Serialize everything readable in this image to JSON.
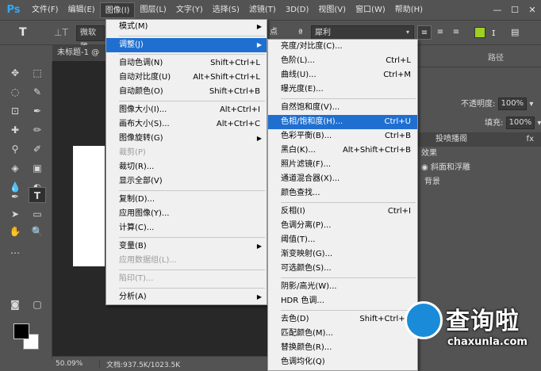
{
  "app": {
    "logo": "Ps"
  },
  "menubar": {
    "items": [
      "文件(F)",
      "编辑(E)",
      "图像(I)",
      "图层(L)",
      "文字(Y)",
      "选择(S)",
      "滤镜(T)",
      "3D(D)",
      "视图(V)",
      "窗口(W)",
      "帮助(H)"
    ],
    "active_index": 2,
    "window_controls": [
      "—",
      "☐",
      "✕"
    ]
  },
  "options": {
    "font_family": "微软雅",
    "font_size_unit": "点",
    "aa": "犀利"
  },
  "document": {
    "tab_title": "未标题-1 @"
  },
  "status": {
    "zoom": "50.09%",
    "doc_info": "文档:937.5K/1023.5K"
  },
  "panels": {
    "tabs": [
      "",
      "",
      "路径"
    ],
    "opacity_label": "不透明度:",
    "opacity_value": "100%",
    "fill_label": "填充:",
    "fill_value": "100%",
    "layer_header": "投喷播阁",
    "fx": "fx",
    "layers": [
      "效果",
      "斜面和浮雕",
      "背景"
    ]
  },
  "image_menu": {
    "items": [
      {
        "label": "模式(M)",
        "shortcut": "",
        "arrow": true,
        "disabled": false
      },
      {
        "sep": true
      },
      {
        "label": "调整(J)",
        "shortcut": "",
        "arrow": true,
        "disabled": false,
        "highlight": true
      },
      {
        "sep": true
      },
      {
        "label": "自动色调(N)",
        "shortcut": "Shift+Ctrl+L",
        "disabled": false
      },
      {
        "label": "自动对比度(U)",
        "shortcut": "Alt+Shift+Ctrl+L",
        "disabled": false
      },
      {
        "label": "自动颜色(O)",
        "shortcut": "Shift+Ctrl+B",
        "disabled": false
      },
      {
        "sep": true
      },
      {
        "label": "图像大小(I)...",
        "shortcut": "Alt+Ctrl+I",
        "disabled": false
      },
      {
        "label": "画布大小(S)...",
        "shortcut": "Alt+Ctrl+C",
        "disabled": false
      },
      {
        "label": "图像旋转(G)",
        "shortcut": "",
        "arrow": true,
        "disabled": false
      },
      {
        "label": "裁剪(P)",
        "shortcut": "",
        "disabled": true
      },
      {
        "label": "裁切(R)...",
        "shortcut": "",
        "disabled": false
      },
      {
        "label": "显示全部(V)",
        "shortcut": "",
        "disabled": false
      },
      {
        "sep": true
      },
      {
        "label": "复制(D)...",
        "shortcut": "",
        "disabled": false
      },
      {
        "label": "应用图像(Y)...",
        "shortcut": "",
        "disabled": false
      },
      {
        "label": "计算(C)...",
        "shortcut": "",
        "disabled": false
      },
      {
        "sep": true
      },
      {
        "label": "变量(B)",
        "shortcut": "",
        "arrow": true,
        "disabled": false
      },
      {
        "label": "应用数据组(L)...",
        "shortcut": "",
        "disabled": true
      },
      {
        "sep": true
      },
      {
        "label": "陷印(T)...",
        "shortcut": "",
        "disabled": true
      },
      {
        "sep": true
      },
      {
        "label": "分析(A)",
        "shortcut": "",
        "arrow": true,
        "disabled": false
      }
    ]
  },
  "adjust_menu": {
    "items": [
      {
        "label": "亮度/对比度(C)...",
        "shortcut": ""
      },
      {
        "label": "色阶(L)...",
        "shortcut": "Ctrl+L"
      },
      {
        "label": "曲线(U)...",
        "shortcut": "Ctrl+M"
      },
      {
        "label": "曝光度(E)...",
        "shortcut": ""
      },
      {
        "sep": true
      },
      {
        "label": "自然饱和度(V)...",
        "shortcut": ""
      },
      {
        "label": "色相/饱和度(H)...",
        "shortcut": "Ctrl+U",
        "highlight": true
      },
      {
        "label": "色彩平衡(B)...",
        "shortcut": "Ctrl+B"
      },
      {
        "label": "黑白(K)...",
        "shortcut": "Alt+Shift+Ctrl+B"
      },
      {
        "label": "照片滤镜(F)...",
        "shortcut": ""
      },
      {
        "label": "通道混合器(X)...",
        "shortcut": ""
      },
      {
        "label": "颜色查找...",
        "shortcut": ""
      },
      {
        "sep": true
      },
      {
        "label": "反相(I)",
        "shortcut": "Ctrl+I"
      },
      {
        "label": "色调分离(P)...",
        "shortcut": ""
      },
      {
        "label": "阈值(T)...",
        "shortcut": ""
      },
      {
        "label": "渐变映射(G)...",
        "shortcut": ""
      },
      {
        "label": "可选颜色(S)...",
        "shortcut": ""
      },
      {
        "sep": true
      },
      {
        "label": "阴影/高光(W)...",
        "shortcut": ""
      },
      {
        "label": "HDR 色调...",
        "shortcut": ""
      },
      {
        "sep": true
      },
      {
        "label": "去色(D)",
        "shortcut": "Shift+Ctrl+U"
      },
      {
        "label": "匹配颜色(M)...",
        "shortcut": ""
      },
      {
        "label": "替换颜色(R)...",
        "shortcut": ""
      },
      {
        "label": "色调均化(Q)",
        "shortcut": ""
      }
    ]
  },
  "watermark": {
    "brand": "查询啦",
    "url": "chaxunla.com"
  }
}
